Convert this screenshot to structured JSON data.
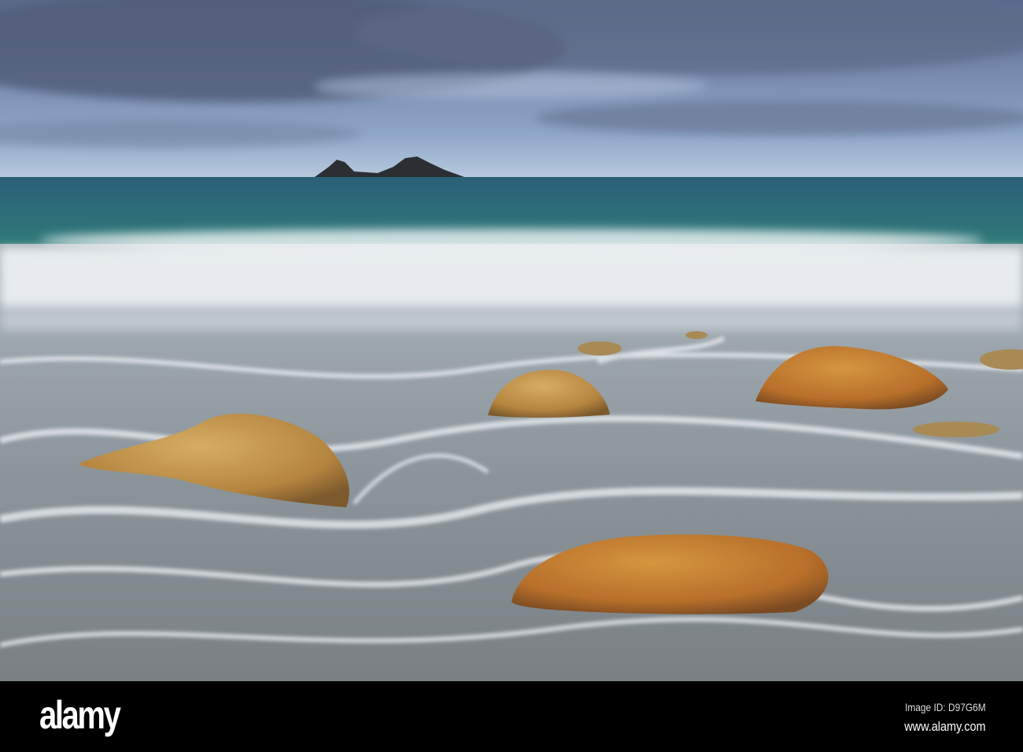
{
  "watermark": {
    "logo": "alamy",
    "image_id": "Image ID: D97G6M",
    "url": "www.alamy.com"
  },
  "colors": {
    "sky": "#6f85a8",
    "sea": "#2f6e78",
    "foam": "#e8eef2",
    "boulder": "#c69a4e",
    "bar": "#000000"
  }
}
